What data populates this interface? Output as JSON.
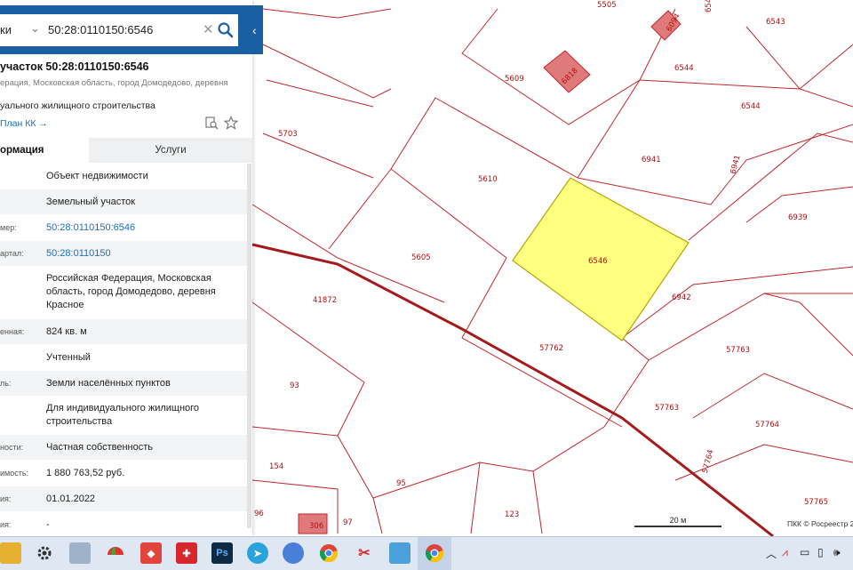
{
  "search": {
    "type_label": "ки",
    "value": "50:28:0110150:6546"
  },
  "object": {
    "title": "участок 50:28:0110150:6546",
    "subtitle": "ерация, Московская область, город Домодедово, деревня",
    "purpose": "уального жилищного строительства",
    "plan_link": "План КК →"
  },
  "tabs": {
    "info": "ормация",
    "services": "Услуги"
  },
  "rows": [
    {
      "label": "",
      "value": "Объект недвижимости"
    },
    {
      "label": "",
      "value": "Земельный участок"
    },
    {
      "label": "мер:",
      "value": "50:28:0110150:6546"
    },
    {
      "label": "артал:",
      "value": "50:28:0110150"
    },
    {
      "label": "",
      "value": "Российская Федерация, Московская область, город Домодедово, деревня Красное"
    },
    {
      "label": "енная:",
      "value": "824 кв. м"
    },
    {
      "label": "",
      "value": "Учтенный"
    },
    {
      "label": "ль:",
      "value": "Земли населённых пунктов"
    },
    {
      "label": "",
      "value": "Для индивидуального жилищного строительства"
    },
    {
      "label": "ности:",
      "value": "Частная собственность"
    },
    {
      "label": "имость:",
      "value": "1 880 763,52 руб."
    },
    {
      "label": "ия:",
      "value": "01.01.2022"
    },
    {
      "label": "ия:",
      "value": "-"
    }
  ],
  "map": {
    "parcels": [
      "6543",
      "6544",
      "6544",
      "5609",
      "6818",
      "6094",
      "5703",
      "6941",
      "6941",
      "5610",
      "6939",
      "5605",
      "6546",
      "6942",
      "41872",
      "57762",
      "57763",
      "57763",
      "57764",
      "93",
      "154",
      "95",
      "57764",
      "123",
      "97",
      "57765",
      "306",
      "96",
      "5505",
      "654"
    ],
    "scale_label": "20 м",
    "copyright": "ПКК © Росреестр 2"
  },
  "colors": {
    "header_blue": "#1b5fa3",
    "parcel_line": "#c0282d",
    "selected_fill": "#ffff80",
    "building_fill": "#e07a7a"
  },
  "taskbar": {
    "icons": [
      "file-explorer-icon",
      "settings-gear-icon",
      "image-viewer-icon",
      "umbrella-app-icon",
      "anydesk-icon",
      "app-red-icon",
      "photoshop-icon",
      "telegram-icon",
      "unknown-app-icon",
      "chrome-icon",
      "scissors-tool-icon",
      "image-app-icon",
      "chrome-active-icon"
    ],
    "photoshop_label": "Ps",
    "tray_icons": [
      "chevron-up-icon",
      "network-icon",
      "monitor-icon",
      "usb-icon",
      "volume-icon"
    ]
  }
}
